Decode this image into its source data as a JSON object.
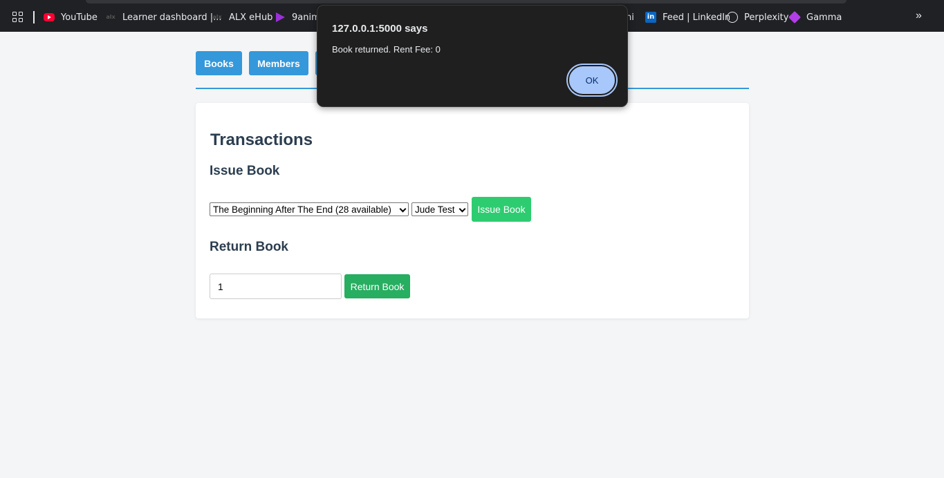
{
  "bookmarks": [
    {
      "label": "YouTube",
      "icon": "youtube-icon"
    },
    {
      "label": "Learner dashboard |...",
      "icon": "alx-icon"
    },
    {
      "label": "ALX eHub",
      "icon": "alx-icon"
    },
    {
      "label": "9anime",
      "icon": "9anime-icon"
    },
    {
      "label": "ni",
      "icon": ""
    },
    {
      "label": "Feed | LinkedIn",
      "icon": "linkedin-icon"
    },
    {
      "label": "Perplexity",
      "icon": "perplexity-icon"
    },
    {
      "label": "Gamma",
      "icon": "gamma-icon"
    }
  ],
  "bookmark_icon_text": {
    "alx": "alx",
    "linkedin": "in"
  },
  "more_label": "»",
  "nav": {
    "books": "Books",
    "members": "Members"
  },
  "card": {
    "title": "Transactions",
    "issue": {
      "heading": "Issue Book",
      "book_select": "The Beginning After The End (28 available)",
      "member_select": "Jude Test",
      "button": "Issue Book"
    },
    "return": {
      "heading": "Return Book",
      "input_value": "1",
      "button": "Return Book"
    }
  },
  "dialog": {
    "title": "127.0.0.1:5000 says",
    "message": "Book returned. Rent Fee: 0",
    "ok": "OK"
  },
  "colors": {
    "primary": "#3498db",
    "issue_green": "#2ecc71",
    "return_green": "#27ae60",
    "dialog_bg": "#1f1f1f",
    "ok_button": "#a8c7fa"
  }
}
